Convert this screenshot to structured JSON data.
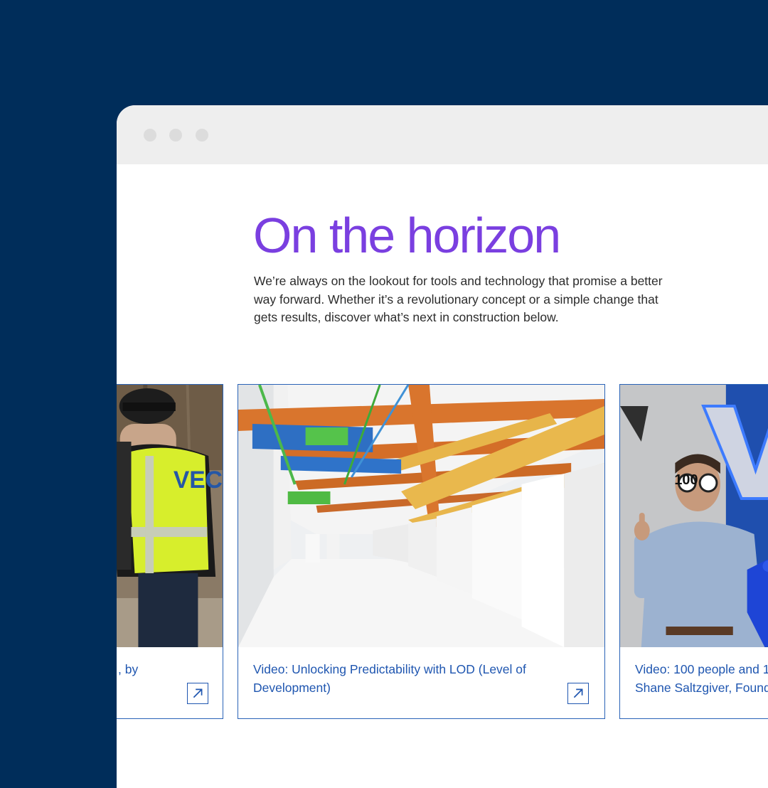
{
  "page": {
    "heading": "On the horizon",
    "intro": "We’re always on the lookout for tools and technology that promise a better way forward. Whether it’s a revolutionary concept or a simple change that gets results, discover what’s next in construction below."
  },
  "cards": [
    {
      "title": ", by",
      "image": "construction-worker-vest-photo",
      "icon": "external-arrow-icon"
    },
    {
      "title": "Video: Unlocking Predictability with LOD (Level of Development)",
      "image": "bim-ceiling-model-render",
      "icon": "external-arrow-icon"
    },
    {
      "title": "Video: 100 people and 1 Shane Saltzgiver, Found",
      "image": "person-100-glasses-photo"
    }
  ],
  "vest_logo": "VEC",
  "glasses_text": "100",
  "colors": {
    "background": "#002d5a",
    "heading": "#7a3fe0",
    "link": "#1f56b0",
    "card_border": "#2a63b7"
  }
}
